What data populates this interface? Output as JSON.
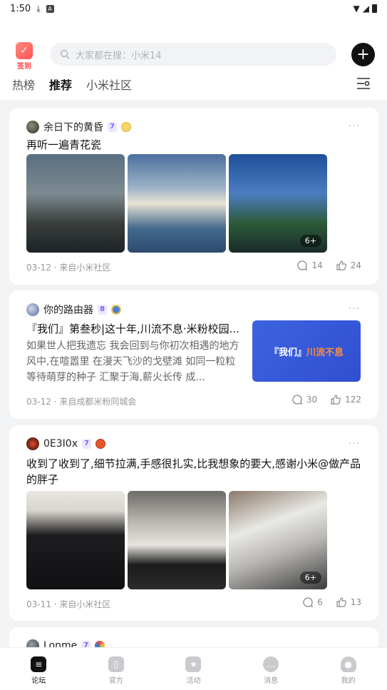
{
  "status_bar": {
    "time": "1:50"
  },
  "header": {
    "signin_label": "签到",
    "search_placeholder": "大家都在搜：小米14",
    "tabs": [
      {
        "label": "热榜",
        "active": false
      },
      {
        "label": "推荐",
        "active": true
      },
      {
        "label": "小米社区",
        "active": false
      }
    ]
  },
  "posts": [
    {
      "author": "余日下的黄昏",
      "level": "7",
      "title": "再听一遍青花瓷",
      "image_count": "6+",
      "date_source": "03-12 · 来自小米社区",
      "comments": "14",
      "likes": "24"
    },
    {
      "author": "你的路由器",
      "level": "8",
      "title": "『我们』第叁秒|这十年,川流不息·米粉校园...",
      "body": "如果世人把我遗忘 我会回到与你初次相遇的地方 风中,在喧嚣里 在漫天飞沙的戈壁滩 如同一粒粒等待萌芽的种子 汇聚于海,薪火长传 成...",
      "thumb_text_white": "『我们』",
      "thumb_text_orange": "川流不息",
      "date_source": "03-12 · 来自成都米粉同城会",
      "comments": "30",
      "likes": "122"
    },
    {
      "author": "0E3I0x",
      "level": "7",
      "title": "收到了收到了,细节拉满,手感很扎实,比我想象的要大,感谢小米@做产品的胖子",
      "image_count": "6+",
      "date_source": "03-11 · 来自小米社区",
      "comments": "6",
      "likes": "13"
    },
    {
      "author": "Lonme",
      "level": "7"
    }
  ],
  "bottom_nav": [
    {
      "label": "论坛",
      "active": true
    },
    {
      "label": "官方",
      "active": false
    },
    {
      "label": "活动",
      "active": false
    },
    {
      "label": "消息",
      "active": false
    },
    {
      "label": "我的",
      "active": false
    }
  ],
  "colors": {
    "accent": "#7b61ff",
    "signin": "#ff4d4f",
    "thumb_bg": "#3d63e0"
  }
}
